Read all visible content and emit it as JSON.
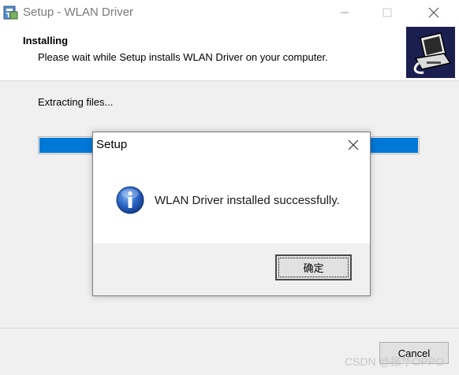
{
  "window": {
    "title": "Setup - WLAN Driver",
    "header_title": "Installing",
    "header_subtitle": "Please wait while Setup installs WLAN Driver on your computer.",
    "status": "Extracting files...",
    "progress": 1.0,
    "cancel_label": "Cancel"
  },
  "dialog": {
    "title": "Setup",
    "message": "WLAN Driver installed successfully.",
    "ok_label": "确定",
    "icon": "info-icon"
  },
  "watermark": "CSDN @振华OPPO",
  "colors": {
    "progress_fill": "#0078d7",
    "header_image_bg": "#1a1f4f",
    "info_icon": "#1f5fbf"
  }
}
